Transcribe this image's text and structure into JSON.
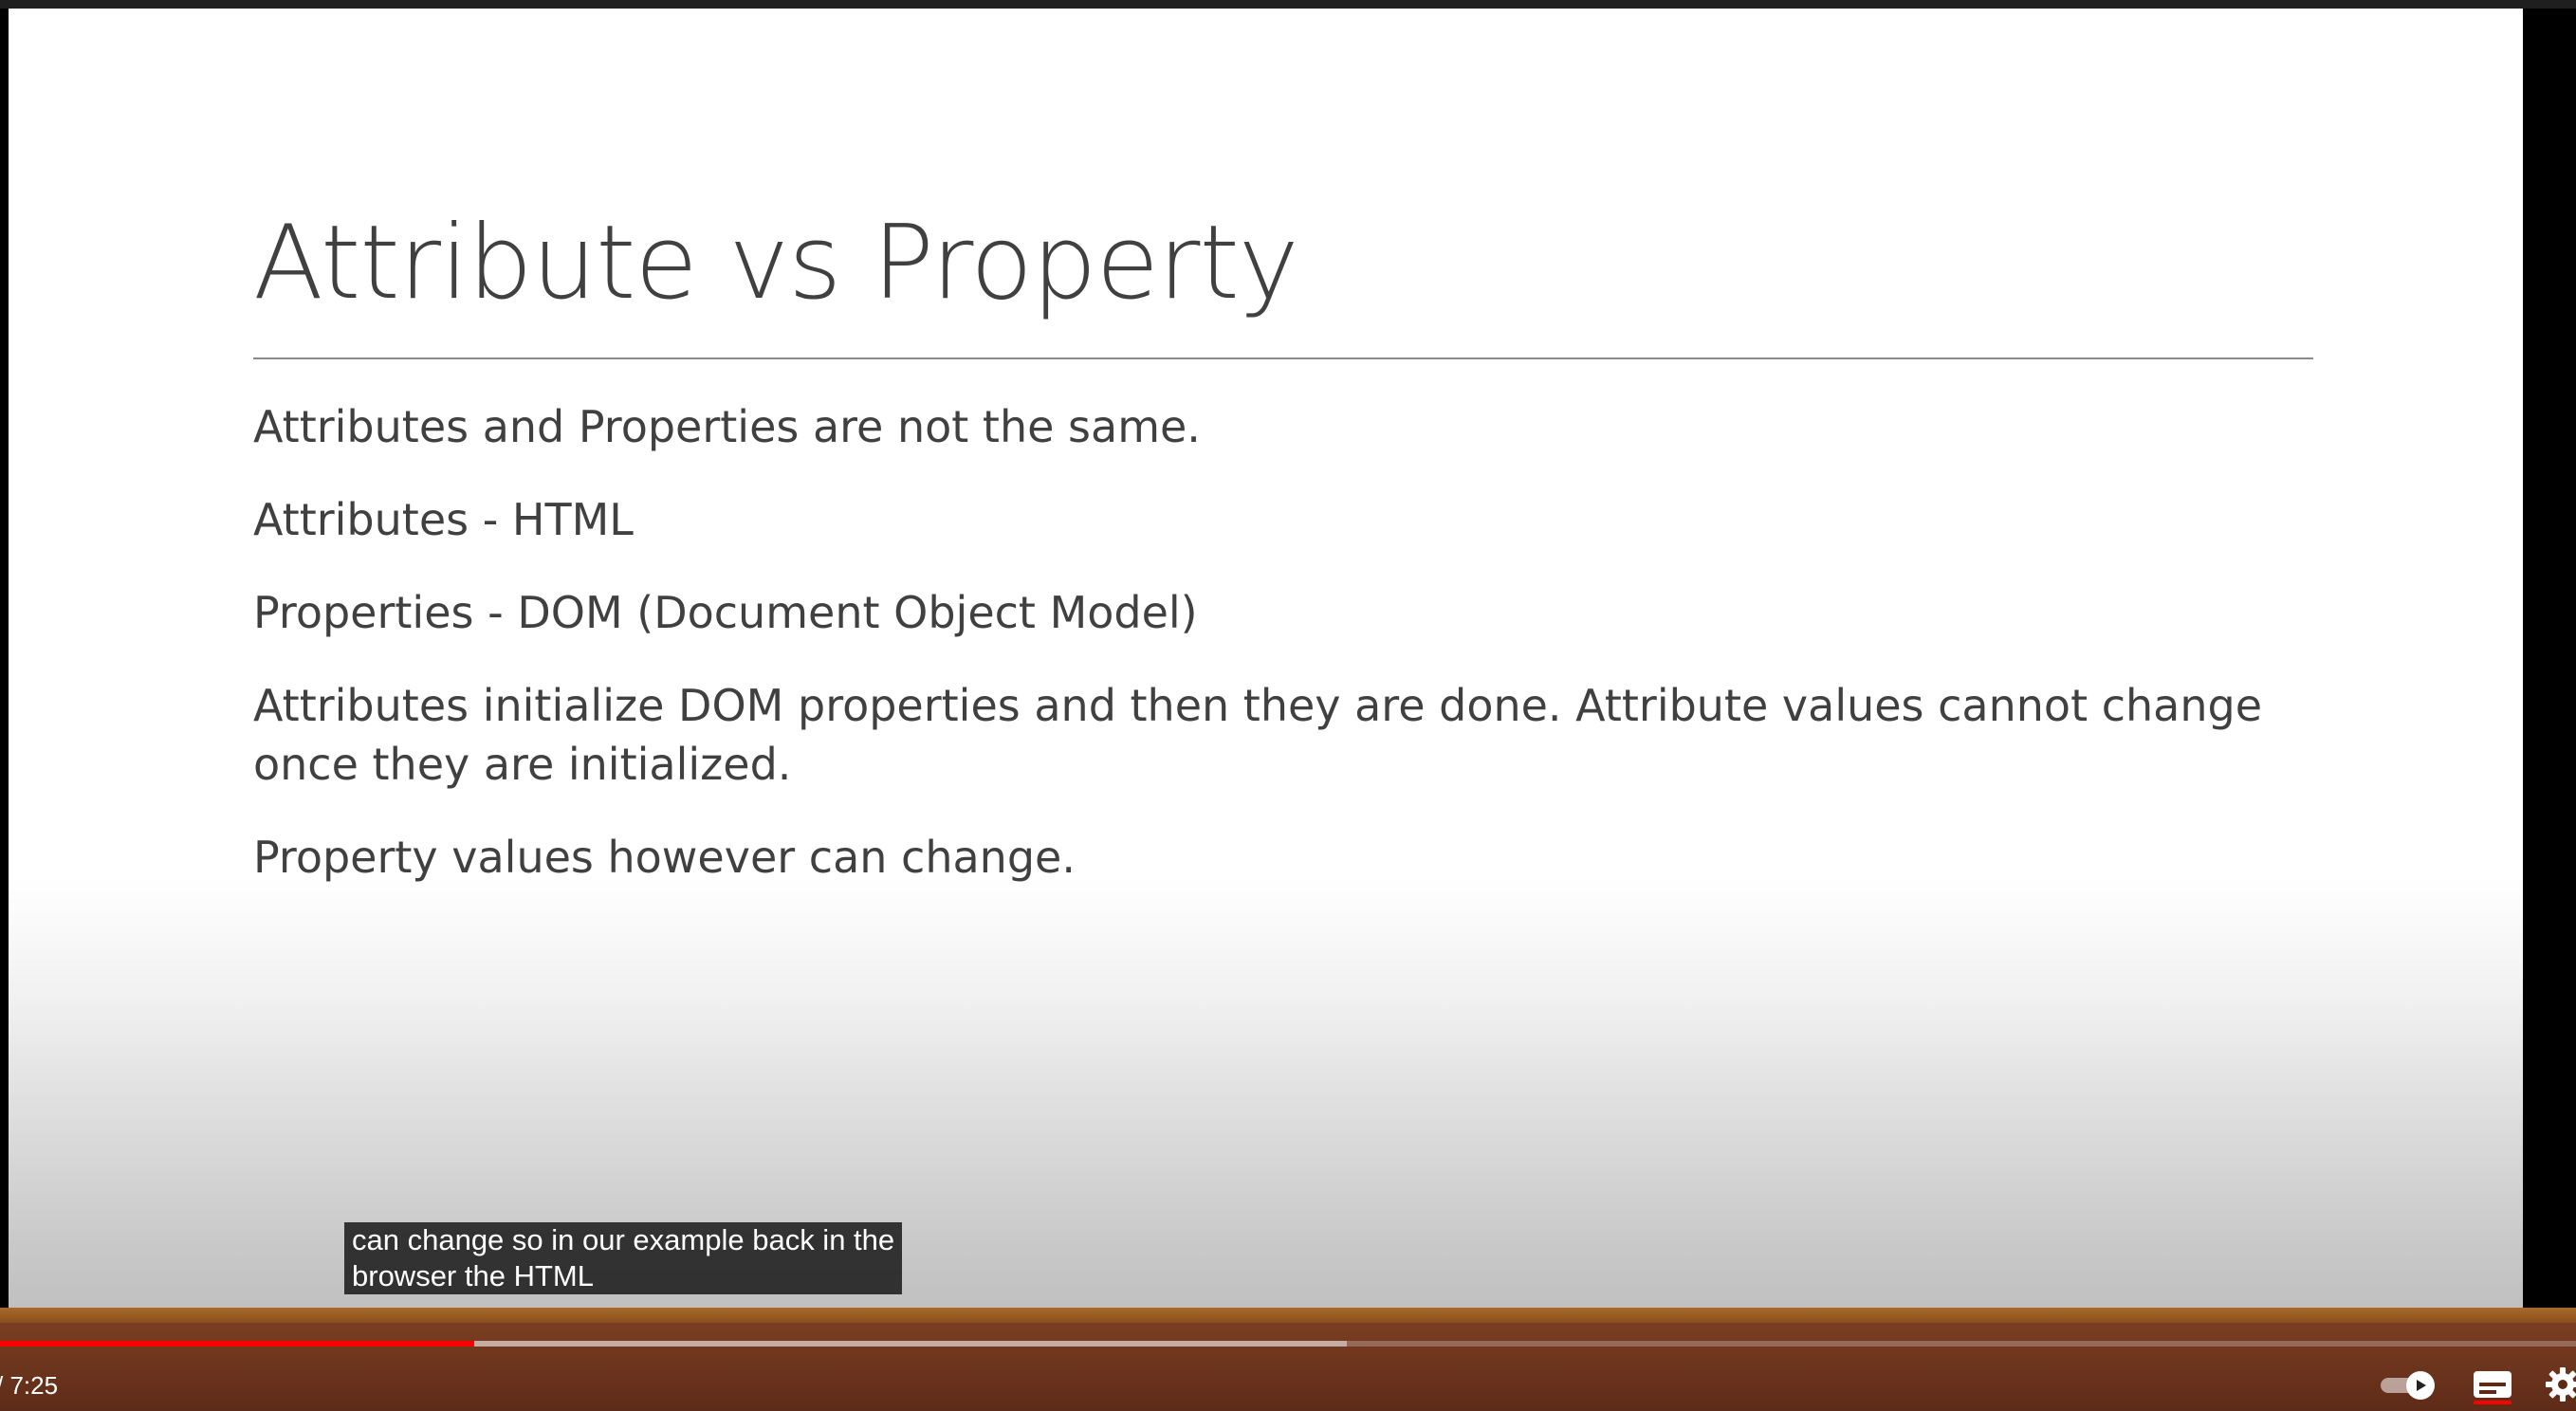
{
  "slide": {
    "title": "Attribute vs Property",
    "bullets": [
      "Attributes and Properties are not the same.",
      "Attributes - HTML",
      "Properties  - DOM (Document Object Model)",
      "Attributes initialize DOM properties and then they are done. Attribute values cannot change once they are initialized.",
      "Property values however can change."
    ]
  },
  "caption": {
    "line1": "can change so in our example back in the",
    "line2": "browser the HTML"
  },
  "player": {
    "time_display": "/ 7:25",
    "progress_fraction": 0.184,
    "buffered_fraction": 0.523,
    "autoplay_on": true,
    "captions_on": true,
    "icons": {
      "autoplay": "autoplay-toggle-icon",
      "captions": "subtitles-icon",
      "settings": "gear-icon"
    },
    "colors": {
      "played": "#ff0000",
      "controls_bg": "#5e2b18",
      "band": "#a86a26"
    }
  }
}
